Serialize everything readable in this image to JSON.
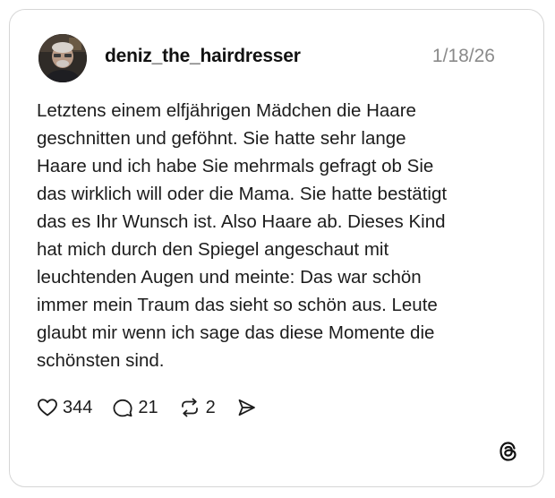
{
  "post": {
    "author": {
      "username": "deniz_the_hairdresser",
      "avatar_icon": "avatar-photo"
    },
    "date": "1/18/26",
    "text": "Letztens einem elfjährigen Mädchen die Haare\ngeschnitten und geföhnt. Sie hatte sehr lange\nHaare und ich habe Sie mehrmals gefragt ob Sie\ndas wirklich will oder die Mama. Sie hatte bestätigt\ndas es Ihr Wunsch ist. Also Haare ab. Dieses Kind\nhat mich durch den Spiegel angeschaut mit\nleuchtenden Augen und meinte: Das war schön\nimmer mein Traum das sieht so schön aus. Leute\nglaubt mir wenn ich sage das diese Momente die\nschönsten sind."
  },
  "actions": {
    "likes": {
      "icon": "heart-icon",
      "count": "344"
    },
    "replies": {
      "icon": "comment-icon",
      "count": "21"
    },
    "reposts": {
      "icon": "repost-icon",
      "count": "2"
    },
    "share": {
      "icon": "send-icon"
    }
  },
  "branding": {
    "logo": "threads-logo-icon"
  },
  "colors": {
    "border": "#d6d6d6",
    "text": "#1c1c1c",
    "muted": "#8a8a8a",
    "background": "#ffffff"
  }
}
